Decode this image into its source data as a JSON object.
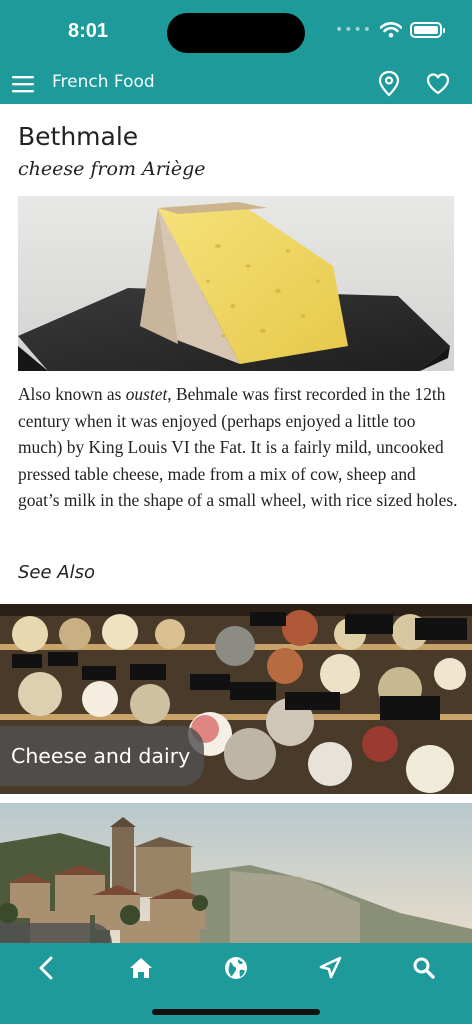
{
  "status_bar": {
    "time": "8:01"
  },
  "app_bar": {
    "title": "French Food"
  },
  "article": {
    "title": "Bethmale",
    "subtitle": "cheese from Ariège",
    "body_before_em": "Also known as ",
    "body_em": "oustet",
    "body_after_em": ", Behmale was first recorded in the 12th century when it was enjoyed (perhaps enjoyed a little too much) by King Louis VI the Fat. It is a fairly mild, uncooked pressed table cheese, made from a mix of cow, sheep and goat’s milk in the shape of a small wheel, with rice sized holes.",
    "see_also": "See Also"
  },
  "related": [
    {
      "label": "Cheese and dairy"
    },
    {
      "label": ""
    }
  ],
  "colors": {
    "brand": "#1f9a9a"
  },
  "bottom_nav": {
    "icons": [
      "back-icon",
      "home-icon",
      "globe-icon",
      "navigate-icon",
      "search-icon"
    ]
  }
}
